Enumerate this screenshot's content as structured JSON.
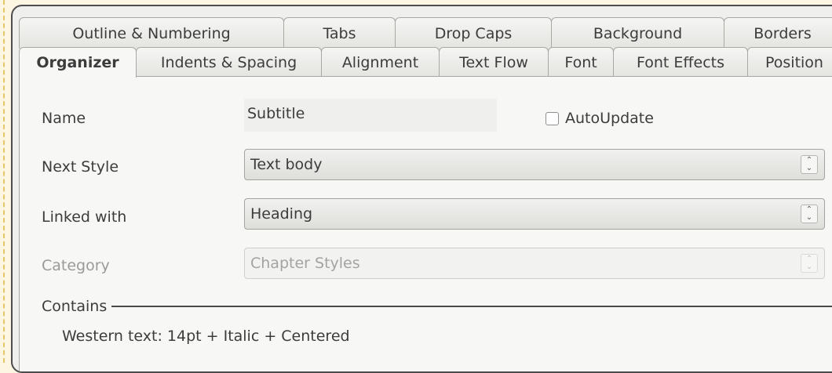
{
  "tabs_back": [
    "Outline & Numbering",
    "Tabs",
    "Drop Caps",
    "Background",
    "Borders"
  ],
  "tabs_front": [
    "Organizer",
    "Indents & Spacing",
    "Alignment",
    "Text Flow",
    "Font",
    "Font Effects",
    "Position"
  ],
  "active_tab": "Organizer",
  "organizer": {
    "name_label": "Name",
    "name_value": "Subtitle",
    "autoupdate_label": "AutoUpdate",
    "autoupdate_checked": false,
    "next_style_label": "Next Style",
    "next_style_value": "Text body",
    "linked_with_label": "Linked with",
    "linked_with_value": "Heading",
    "category_label": "Category",
    "category_value": "Chapter Styles",
    "contains_label": "Contains",
    "contains_text": "Western text: 14pt + Italic + Centered"
  },
  "icons": {
    "spin": "up-down-arrows-icon",
    "checkbox": "checkbox-unchecked-icon"
  }
}
